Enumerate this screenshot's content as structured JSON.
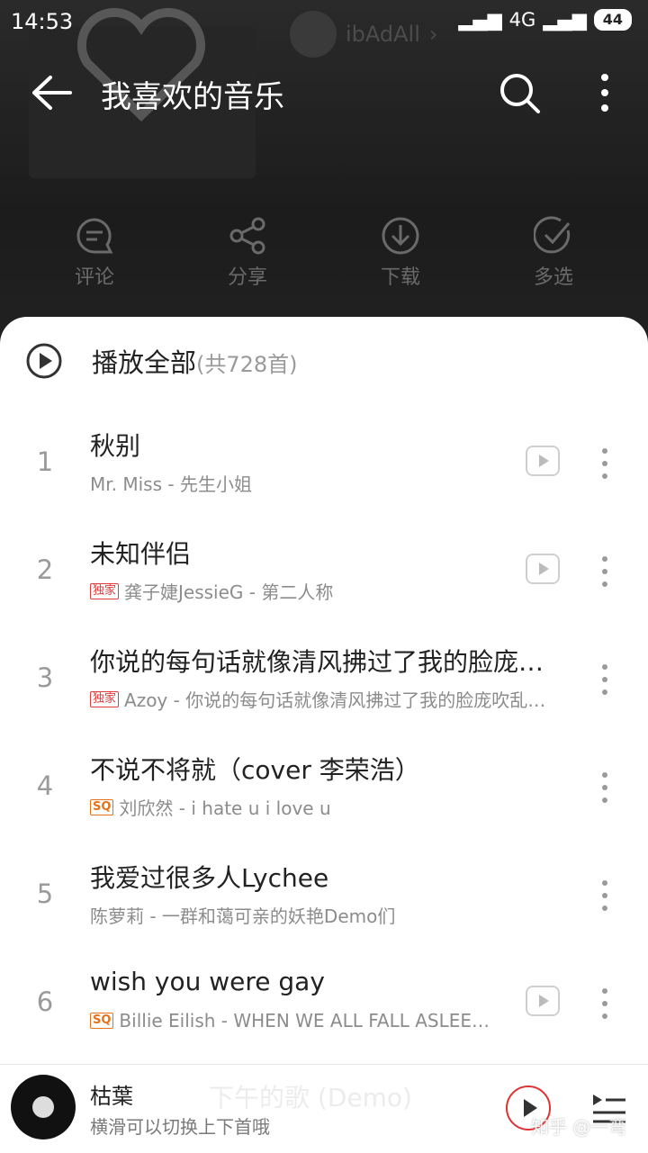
{
  "status": {
    "time": "14:53",
    "network": "4G",
    "battery": "44"
  },
  "header": {
    "title": "我喜欢的音乐",
    "user_name": "ibAdAll",
    "back_icon": "arrow-left-icon",
    "search_icon": "search-icon",
    "more_icon": "more-vertical-icon"
  },
  "actions": [
    {
      "label": "评论",
      "icon": "comment-icon"
    },
    {
      "label": "分享",
      "icon": "share-icon"
    },
    {
      "label": "下载",
      "icon": "download-icon"
    },
    {
      "label": "多选",
      "icon": "multi-select-icon"
    }
  ],
  "play_all": {
    "label": "播放全部",
    "count": "(共728首)"
  },
  "songs": [
    {
      "index": "1",
      "title": "秋别",
      "badge": "",
      "subtitle": "Mr. Miss - 先生小姐",
      "has_mv": true
    },
    {
      "index": "2",
      "title": "未知伴侣",
      "badge": "独家",
      "subtitle": "龚子婕JessieG - 第二人称",
      "has_mv": true
    },
    {
      "index": "3",
      "title": "你说的每句话就像清风拂过了我的脸庞…",
      "badge": "独家",
      "subtitle": "Azoy - 你说的每句话就像清风拂过了我的脸庞吹乱…",
      "has_mv": false
    },
    {
      "index": "4",
      "title": "不说不将就（cover 李荣浩）",
      "badge": "SQ",
      "subtitle": "刘欣然 - i hate u i love u",
      "has_mv": false
    },
    {
      "index": "5",
      "title": "我爱过很多人Lychee",
      "badge": "",
      "subtitle": "陈萝莉 - 一群和蔼可亲的妖艳Demo们",
      "has_mv": false
    },
    {
      "index": "6",
      "title": "wish you were gay",
      "badge": "SQ",
      "subtitle": "Billie Eilish - WHEN WE ALL FALL ASLEEP,…",
      "has_mv": true
    }
  ],
  "now_playing": {
    "title": "枯葉",
    "subtitle": "横滑可以切换上下首哦",
    "ghost_text": "下午的歌 (Demo)"
  },
  "watermark": "知乎 @一弯",
  "colors": {
    "accent": "#dd3333",
    "badge_exclusive": "#e03c3c",
    "badge_sq": "#e5721b"
  }
}
